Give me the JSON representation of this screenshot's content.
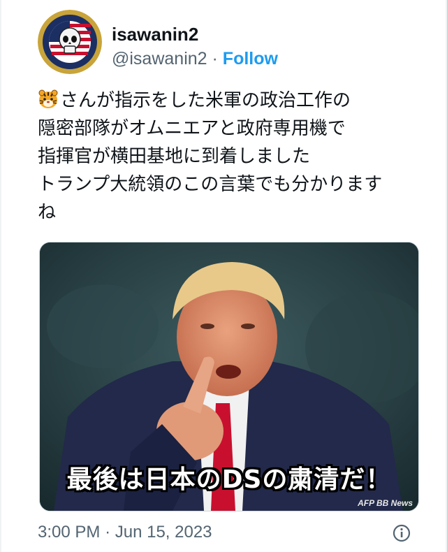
{
  "user": {
    "display_name": "isawanin2",
    "handle": "@isawanin2",
    "separator": "·",
    "follow_label": "Follow"
  },
  "tweet": {
    "emoji": "tiger-face-emoji",
    "lines": [
      "さんが指示をした米軍の政治工作の",
      "隠密部隊がオムニエアと政府専用機で",
      "指揮官が横田基地に到着しました",
      "トランプ大統領のこの言葉でも分かります",
      "ね"
    ]
  },
  "media": {
    "caption": "最後は日本のDSの粛清だ！",
    "credit": "AFP BB News"
  },
  "footer": {
    "time": "3:00 PM",
    "separator": "·",
    "date": "Jun 15, 2023"
  },
  "colors": {
    "link": "#1d9bf0",
    "secondary_text": "#536471",
    "primary_text": "#0f1419"
  }
}
